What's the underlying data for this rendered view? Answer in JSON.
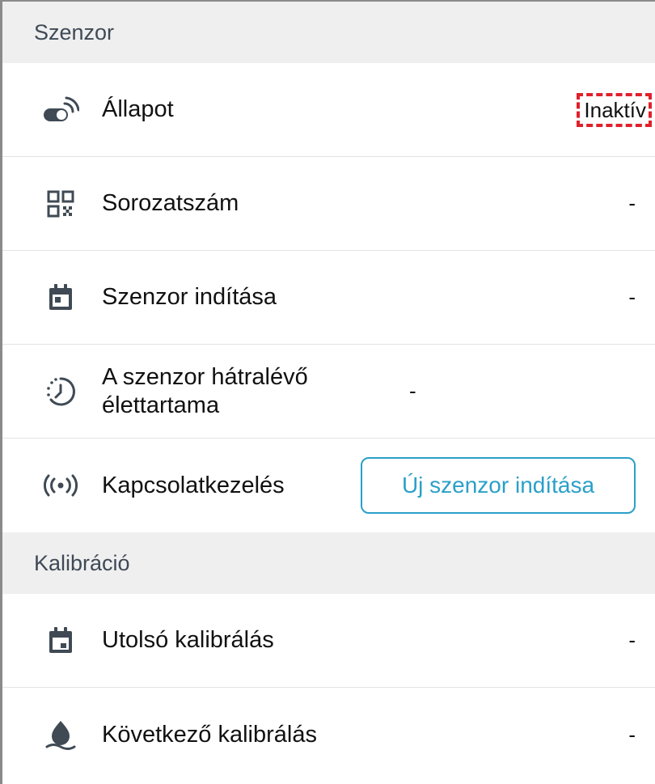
{
  "sensor_section": {
    "header": "Szenzor",
    "rows": [
      {
        "label": "Állapot",
        "value": "Inaktív",
        "icon": "sensor-toggle-icon"
      },
      {
        "label": "Sorozatszám",
        "value": "-",
        "icon": "qr-code-icon"
      },
      {
        "label": "Szenzor indítása",
        "value": "-",
        "icon": "calendar-icon"
      },
      {
        "label": "A szenzor hátralévő élettartama",
        "value": "-",
        "icon": "timer-icon"
      },
      {
        "label": "Kapcsolatkezelés",
        "button": "Új szenzor indítása",
        "icon": "signal-icon"
      }
    ]
  },
  "calibration_section": {
    "header": "Kalibráció",
    "rows": [
      {
        "label": "Utolsó kalibrálás",
        "value": "-",
        "icon": "calendar-icon"
      },
      {
        "label": "Következő kalibrálás",
        "value": "-",
        "icon": "drop-icon"
      }
    ]
  },
  "colors": {
    "accent": "#2aa0c8",
    "icon": "#3f4a55",
    "section_bg": "#efeff0",
    "highlight_dashed": "#e0202b"
  }
}
